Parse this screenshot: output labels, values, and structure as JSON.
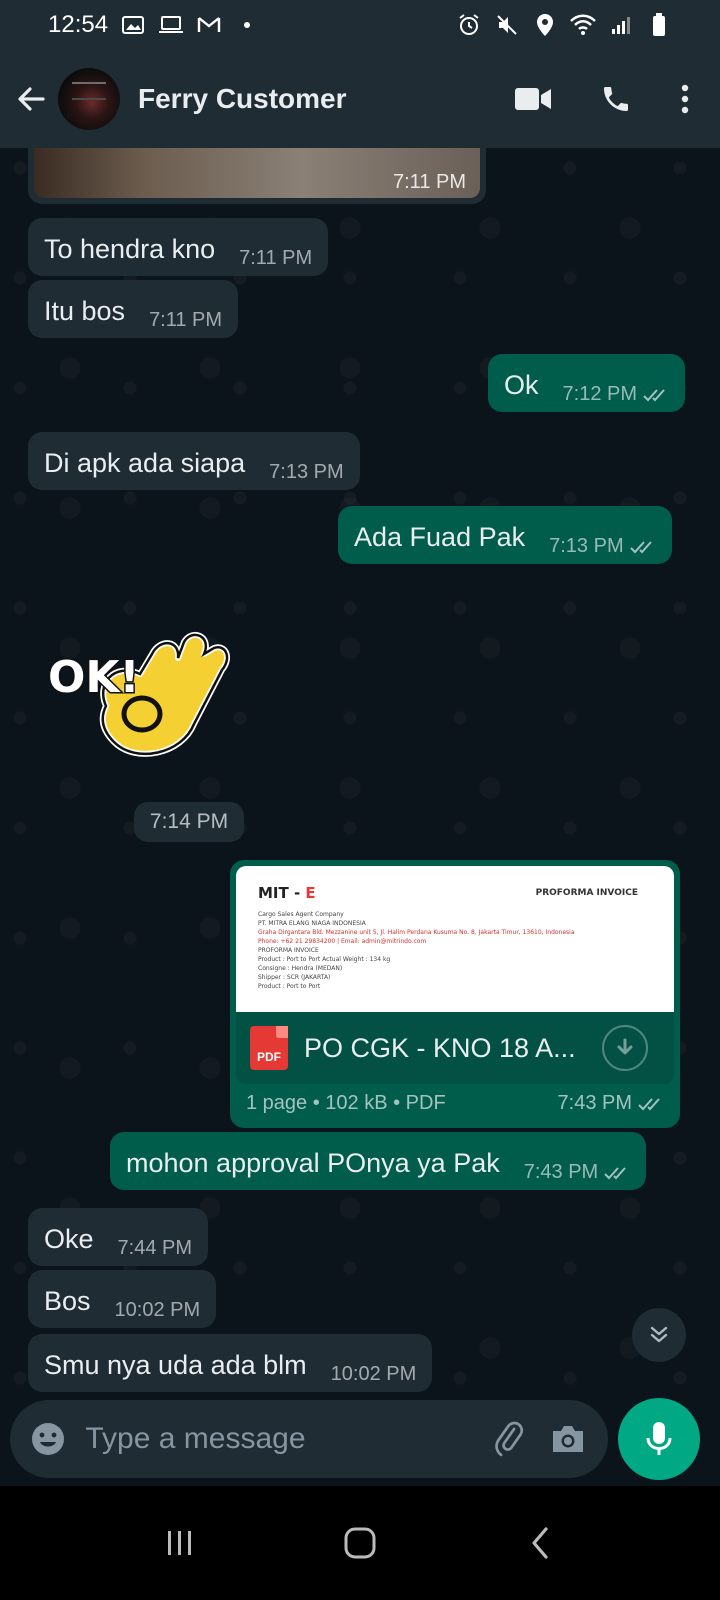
{
  "status_bar": {
    "time": "12:54",
    "left_icons": [
      "gallery-icon",
      "laptop-icon",
      "gmail-icon",
      "dot-icon"
    ],
    "right_icons": [
      "alarm-icon",
      "mute-icon",
      "location-icon",
      "wifi-icon",
      "signal-icon",
      "battery-icon"
    ]
  },
  "header": {
    "contact_name": "Ferry Customer",
    "icons": [
      "back-arrow-icon",
      "video-call-icon",
      "voice-call-icon",
      "more-options-icon"
    ]
  },
  "messages": [
    {
      "dir": "in",
      "type": "image",
      "time": "7:11 PM"
    },
    {
      "dir": "in",
      "type": "text",
      "text": "To hendra kno",
      "time": "7:11 PM"
    },
    {
      "dir": "in",
      "type": "text",
      "text": "Itu bos",
      "time": "7:11 PM"
    },
    {
      "dir": "out",
      "type": "text",
      "text": "Ok",
      "time": "7:12 PM",
      "status": "read"
    },
    {
      "dir": "in",
      "type": "text",
      "text": "Di apk ada siapa",
      "time": "7:13 PM"
    },
    {
      "dir": "out",
      "type": "text",
      "text": "Ada Fuad Pak",
      "time": "7:13 PM",
      "status": "read"
    },
    {
      "dir": "in",
      "type": "sticker",
      "sticker_text": "OK!",
      "time": "7:14 PM"
    },
    {
      "dir": "out",
      "type": "document",
      "file_name": "PO CGK - KNO 18 A...",
      "file_type_label": "PDF",
      "details": "1 page • 102 kB • PDF",
      "time": "7:43 PM",
      "status": "read",
      "preview": {
        "brand": "MIT - ",
        "brand_accent": "E",
        "title": "PROFORMA INVOICE",
        "lines": [
          "Cargo Sales Agent Company",
          "PT. MITRA ELANG NIAGA INDONESIA",
          "Graha Dirgantara Bld. Mezzanine unit 5, Jl. Halim Perdana Kusuma No. 8, Jakarta Timur, 13610, Indonesia",
          "Phone: +62 21 29834200 | Email: admin@mitrindo.com",
          "PROFORMA INVOICE",
          "Product          : Port to Port                          Actual Weight          : 134 kg",
          "Consigne         : Hendra (MEDAN)",
          "Shipper          : SCR (JAKARTA)",
          "Product          : Port to Port"
        ]
      }
    },
    {
      "dir": "out",
      "type": "text",
      "text": "mohon approval POnya ya Pak",
      "time": "7:43 PM",
      "status": "read"
    },
    {
      "dir": "in",
      "type": "text",
      "text": "Oke",
      "time": "7:44 PM"
    },
    {
      "dir": "in",
      "type": "text",
      "text": "Bos",
      "time": "10:02 PM"
    },
    {
      "dir": "in",
      "type": "text",
      "text": "Smu nya uda ada blm",
      "time": "10:02 PM"
    }
  ],
  "composer": {
    "placeholder": "Type a message",
    "icons": [
      "emoji-icon",
      "attach-icon",
      "camera-icon",
      "mic-icon"
    ]
  },
  "nav_bar": {
    "icons": [
      "recent-apps-icon",
      "home-icon",
      "back-icon"
    ]
  },
  "colors": {
    "background": "#0b141a",
    "incoming_bubble": "#1f2c34",
    "outgoing_bubble": "#005c4b",
    "accent": "#00a884",
    "pdf_red": "#e53935"
  }
}
